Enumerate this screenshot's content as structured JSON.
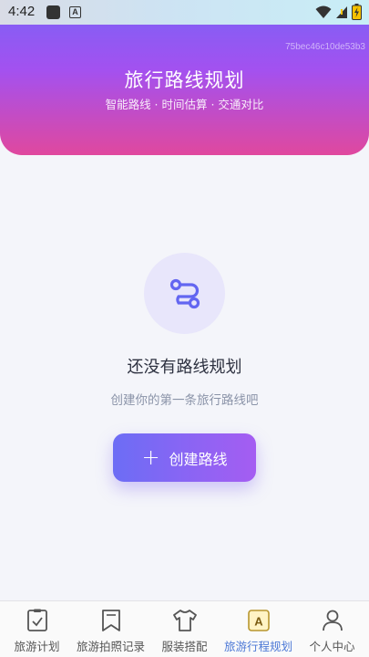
{
  "status_bar": {
    "time": "4:42",
    "icons": [
      "notification-square-icon",
      "a-letter-icon",
      "wifi-icon",
      "signal-icon",
      "battery-charging-icon"
    ],
    "a_letter": "A"
  },
  "header": {
    "device_id": "75bec46c10de53b3",
    "title": "旅行路线规划",
    "subtitle": "智能路线 · 时间估算 · 交通对比"
  },
  "empty_state": {
    "icon": "route-icon",
    "title": "还没有路线规划",
    "subtitle": "创建你的第一条旅行路线吧",
    "button_label": "创建路线",
    "button_icon": "plus-icon"
  },
  "tabbar": {
    "items": [
      {
        "label": "旅游计划",
        "icon": "clipboard-check-icon",
        "active": false
      },
      {
        "label": "旅游拍照记录",
        "icon": "bookmark-icon",
        "active": false
      },
      {
        "label": "服装搭配",
        "icon": "tshirt-icon",
        "active": false
      },
      {
        "label": "旅游行程规划",
        "icon": "a-badge-icon",
        "active": true
      },
      {
        "label": "个人中心",
        "icon": "person-icon",
        "active": false
      }
    ],
    "badge_letter": "A"
  },
  "colors": {
    "header_gradient_top": "#7a63f6",
    "header_gradient_bottom": "#e0489e",
    "accent": "#6c6df5",
    "active_tab": "#4d79d6"
  }
}
